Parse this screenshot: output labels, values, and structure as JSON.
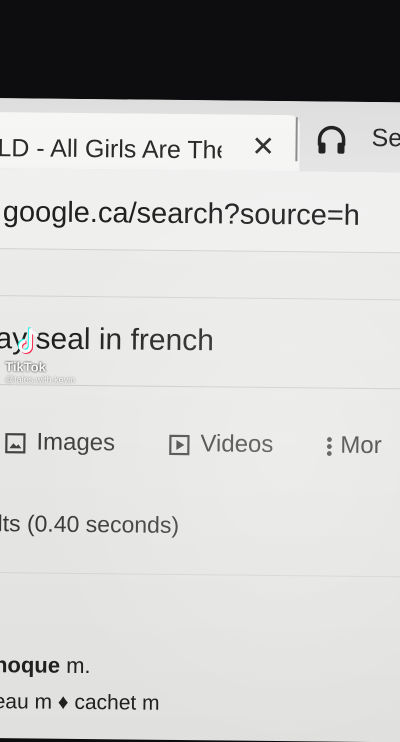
{
  "browser": {
    "active_tab_title": "LD - All Girls Are The",
    "close_glyph": "✕",
    "second_tab_title": "Se",
    "url": "google.ca/search?source=h"
  },
  "search": {
    "query_partial": "ay seal in french"
  },
  "watermark": {
    "brand": "TikTok",
    "handle": "@tales.with.kevin"
  },
  "nav": {
    "images_label": "Images",
    "videos_label": "Videos",
    "more_label": "Mor"
  },
  "stats": {
    "text": "lts (0.40 seconds)"
  },
  "results": {
    "line1_bold": "noque",
    "line1_rest": " m.",
    "line2": "eau m ♦ cachet m"
  },
  "icons": [
    "headphones-icon",
    "images-icon",
    "videos-icon",
    "more-vert-icon",
    "tiktok-logo-icon"
  ],
  "colors": {
    "bezel": "#0d0d0f",
    "page_bg": "#eeeeec",
    "text": "#1f1f1f"
  }
}
